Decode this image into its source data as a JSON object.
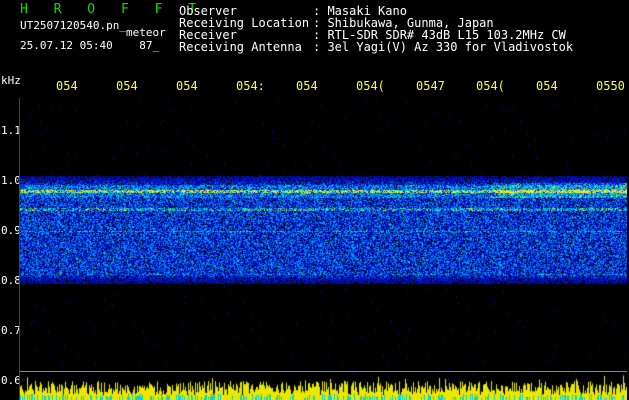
{
  "header": {
    "title": "H R O F F T",
    "filename": "UT2507120540.pn_",
    "tag": "meteor",
    "datetime": "25.07.12 05:40",
    "count": "87_"
  },
  "meta": {
    "labels": [
      "Observer",
      "Receiving Location",
      "Receiver",
      "Receiving Antenna"
    ],
    "values": [
      ": Masaki Kano",
      ": Shibukawa, Gunma, Japan",
      ": RTL-SDR SDR# 43dB L15 103.2MHz CW",
      ": 3el Yagi(V) Az 330 for Vladivostok"
    ]
  },
  "time_ticks": [
    "054",
    "054",
    "054",
    "054:",
    "054",
    "054(",
    "0547",
    "054(",
    "054",
    "0550"
  ],
  "axis": {
    "unit": "kHz",
    "y_labels": [
      "1.1",
      "1.0",
      "0.9",
      "0.8",
      "0.7",
      "0.6"
    ]
  },
  "colors": {
    "title": "#00e000",
    "ticks": "#ffff40",
    "text": "#ffffff",
    "background": "#000000"
  }
}
